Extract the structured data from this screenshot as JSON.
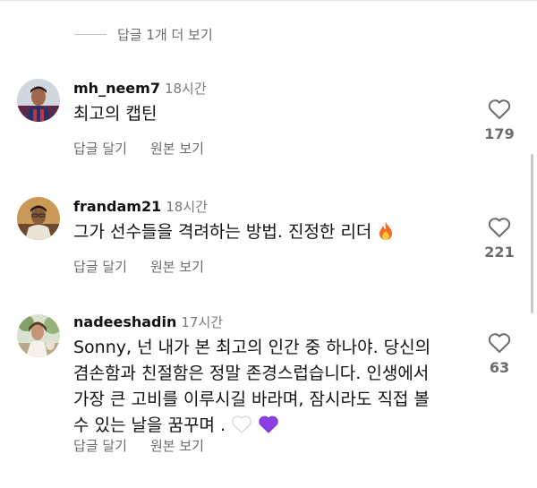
{
  "more_replies": {
    "label": "답글 1개 더 보기"
  },
  "comments": [
    {
      "username": "mh_neem7",
      "time": "18시간",
      "lines": [
        "최고의 캡틴"
      ],
      "actions": {
        "reply": "답글 달기",
        "original": "원본 보기"
      },
      "likes": "179"
    },
    {
      "username": "frandam21",
      "time": "18시간",
      "lines": [
        "그가 선수들을 격려하는 방법. 진정한 리더"
      ],
      "actions": {
        "reply": "답글 달기",
        "original": "원본 보기"
      },
      "likes": "221"
    },
    {
      "username": "nadeeshadin",
      "time": "17시간",
      "lines": [
        "Sonny, 넌 내가 본 최고의 인간 중 하나야. 당신의",
        "겸손함과 친절함은 정말 존경스럽습니다. 인생에서",
        "가장 큰 고비를 이루시길 바라며, 잠시라도 직접 볼",
        "수 있는 날을 꿈꾸며 ."
      ],
      "actions": {
        "reply": "답글 달기",
        "original": "원본 보기"
      },
      "likes": "63"
    }
  ],
  "icons": {
    "like": "heart-outline-icon"
  },
  "colors": {
    "text": "#111111",
    "muted": "#6b6b6b",
    "fire": "#f26b1d",
    "purple_heart": "#8e3ee6",
    "white_heart": "#ffffff"
  }
}
